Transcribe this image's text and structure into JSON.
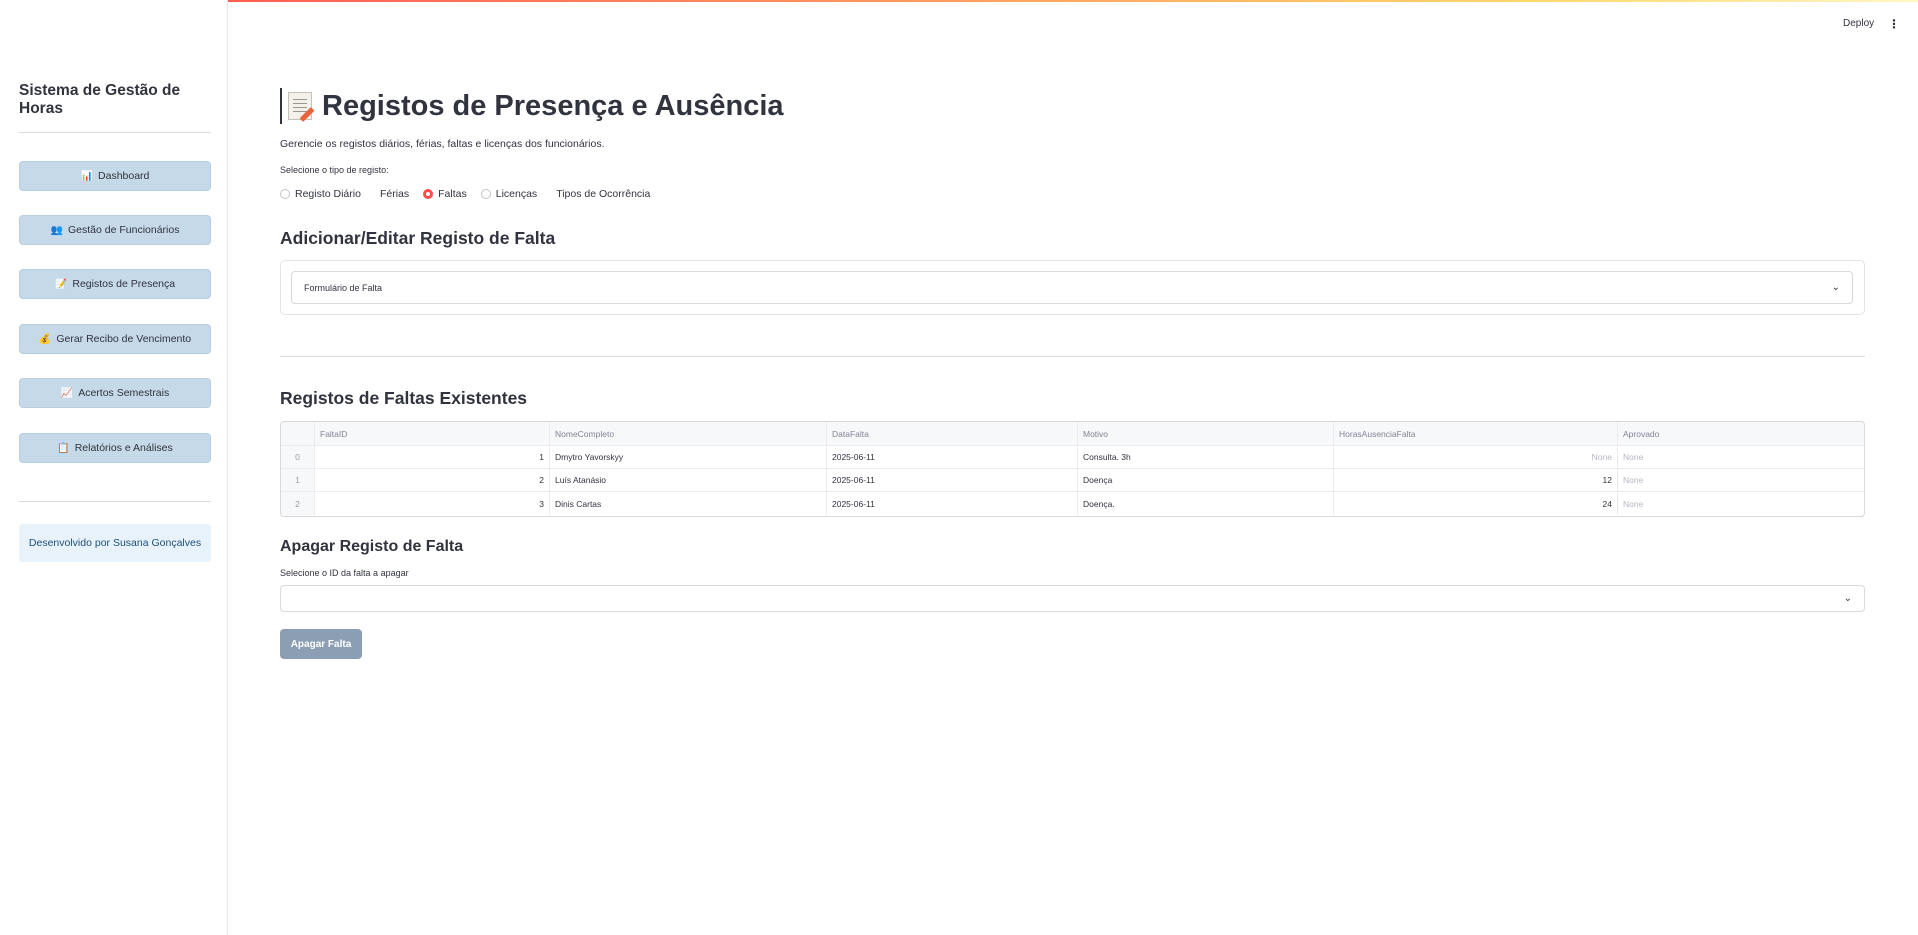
{
  "header": {
    "deploy_label": "Deploy",
    "menu_icon": "kebab-menu-icon"
  },
  "sidebar": {
    "title": "Sistema de Gestão de Horas",
    "items": [
      {
        "icon": "📊",
        "label": "Dashboard"
      },
      {
        "icon": "👥",
        "label": "Gestão de Funcionários"
      },
      {
        "icon": "📝",
        "label": "Registos de Presença"
      },
      {
        "icon": "💰",
        "label": "Gerar Recibo de Vencimento"
      },
      {
        "icon": "📈",
        "label": "Acertos Semestrais"
      },
      {
        "icon": "📋",
        "label": "Relatórios e Análises"
      }
    ],
    "developer": "Desenvolvido por Susana Gonçalves"
  },
  "main": {
    "title": "Registos de Presença e Ausência",
    "subtitle": "Gerencie os registos diários, férias, faltas e licenças dos funcionários.",
    "radio_label": "Selecione o tipo de registo:",
    "radio_options": [
      "Registo Diário",
      "Férias",
      "Faltas",
      "Licenças",
      "Tipos de Ocorrência"
    ],
    "radio_selected": "Faltas",
    "form_heading": "Adicionar/Editar Registo de Falta",
    "form_expander": "Formulário de Falta",
    "table_heading": "Registos de Faltas Existentes",
    "table": {
      "columns": [
        "",
        "FaltaID",
        "NomeCompleto",
        "DataFalta",
        "Motivo",
        "HorasAusenciaFalta",
        "Aprovado"
      ],
      "rows": [
        [
          "0",
          "1",
          "Dmytro Yavorskyy",
          "2025-06-11",
          "Consulta. 3h",
          "None",
          "None"
        ],
        [
          "1",
          "2",
          "Luís Atanásio",
          "2025-06-11",
          "Doença",
          "12",
          "None"
        ],
        [
          "2",
          "3",
          "Dinis Cartas",
          "2025-06-11",
          "Doença.",
          "24",
          "None"
        ]
      ]
    },
    "delete_heading": "Apagar Registo de Falta",
    "delete_select_label": "Selecione o ID da falta a apagar",
    "delete_select_value": "",
    "delete_button": "Apagar Falta"
  },
  "colors": {
    "accent": "#ff4b4b",
    "nav_button": "#c5d9e8",
    "delete_button": "#8b9eb3"
  }
}
